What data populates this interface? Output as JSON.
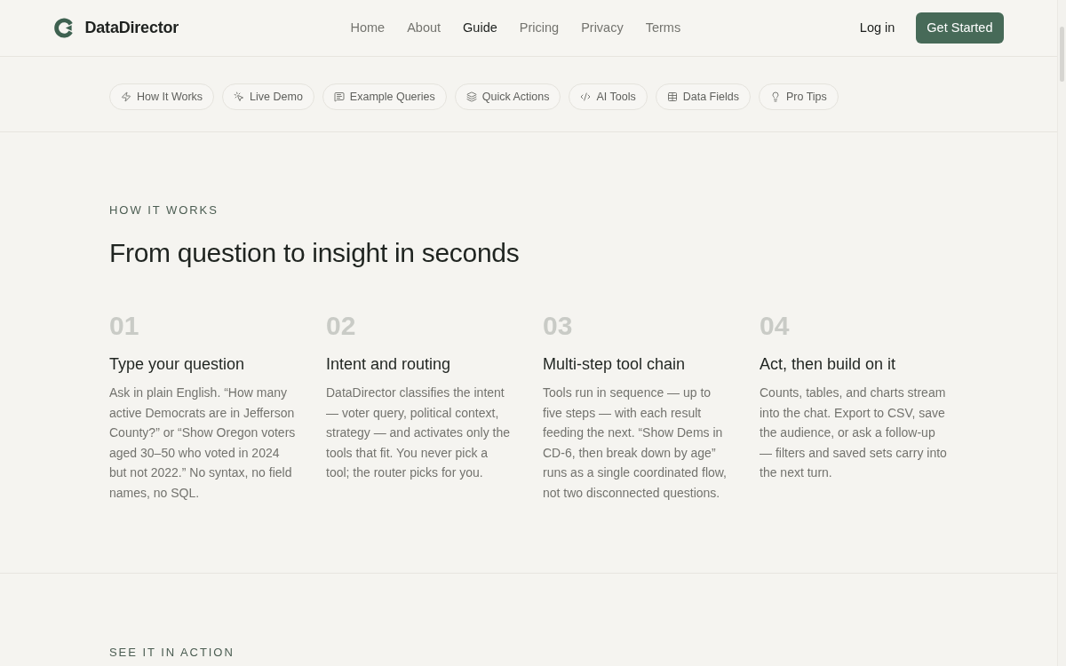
{
  "header": {
    "brand": "DataDirector",
    "nav": [
      {
        "label": "Home",
        "selected": false
      },
      {
        "label": "About",
        "selected": false
      },
      {
        "label": "Guide",
        "selected": true
      },
      {
        "label": "Pricing",
        "selected": false
      },
      {
        "label": "Privacy",
        "selected": false
      },
      {
        "label": "Terms",
        "selected": false
      }
    ],
    "login": "Log in",
    "cta": "Get Started"
  },
  "section_nav": [
    {
      "label": "How It Works"
    },
    {
      "label": "Live Demo"
    },
    {
      "label": "Example Queries"
    },
    {
      "label": "Quick Actions"
    },
    {
      "label": "AI Tools"
    },
    {
      "label": "Data Fields"
    },
    {
      "label": "Pro Tips"
    }
  ],
  "how_it_works": {
    "eyebrow": "HOW IT WORKS",
    "heading": "From question to insight in seconds",
    "steps": [
      {
        "number": "01",
        "title": "Type your question",
        "body": "Ask in plain English. “How many active Democrats are in Jefferson County?” or “Show Oregon voters aged 30–50 who voted in 2024 but not 2022.” No syntax, no field names, no SQL."
      },
      {
        "number": "02",
        "title": "Intent and routing",
        "body": "DataDirector classifies the intent — voter query, political context, strategy — and activates only the tools that fit. You never pick a tool; the router picks for you."
      },
      {
        "number": "03",
        "title": "Multi-step tool chain",
        "body": "Tools run in sequence — up to five steps — with each result feeding the next. “Show Dems in CD-6, then break down by age” runs as a single coordinated flow, not two disconnected questions."
      },
      {
        "number": "04",
        "title": "Act, then build on it",
        "body": "Counts, tables, and charts stream into the chat. Export to CSV, save the audience, or ask a follow-up — filters and saved sets carry into the next turn."
      }
    ]
  },
  "next_section": {
    "eyebrow": "SEE IT IN ACTION"
  }
}
